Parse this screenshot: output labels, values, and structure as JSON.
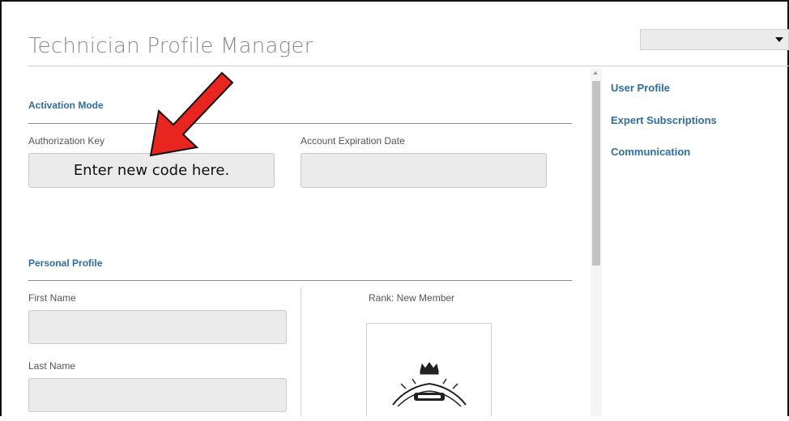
{
  "header": {
    "title": "Technician Profile Manager",
    "dropdown_value": ""
  },
  "activation": {
    "heading": "Activation Mode",
    "auth_key_label": "Authorization Key",
    "auth_key_value": "Enter new code here.",
    "expiration_label": "Account Expiration Date",
    "expiration_value": ""
  },
  "personal": {
    "heading": "Personal Profile",
    "first_name_label": "First Name",
    "first_name_value": "",
    "last_name_label": "Last Name",
    "last_name_value": "",
    "rank": "Rank: New Member"
  },
  "sidebar": {
    "items": [
      {
        "label": "User Profile"
      },
      {
        "label": "Expert Subscriptions"
      },
      {
        "label": "Communication"
      }
    ]
  },
  "colors": {
    "accent": "#2e6da4",
    "callout_arrow": "#e8261f",
    "field_bg": "#ebebeb"
  },
  "icons": {
    "dropdown": "caret-down-icon",
    "callout": "red-arrow-icon",
    "logo": "snap-on-emblem"
  }
}
